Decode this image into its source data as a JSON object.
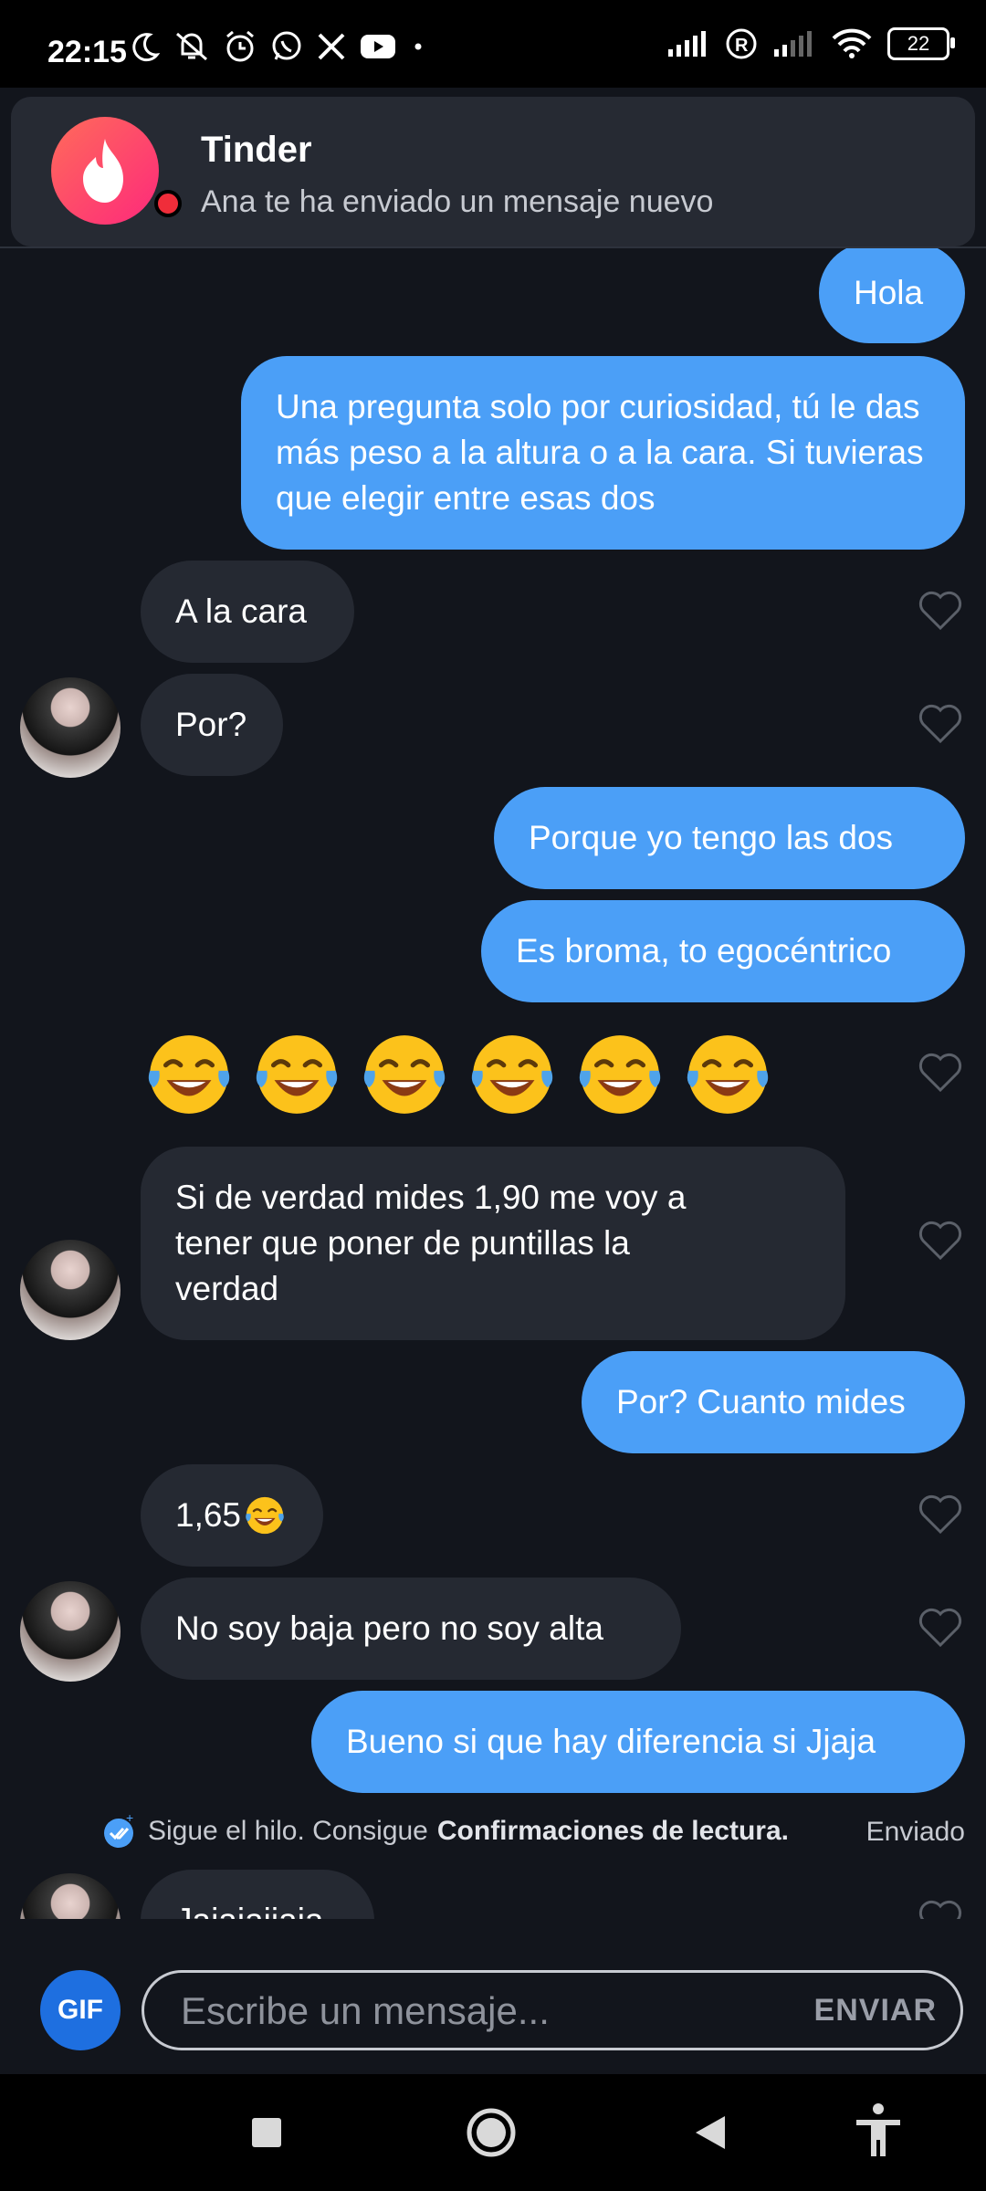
{
  "status_bar": {
    "time": "22:15",
    "battery": "22"
  },
  "notification": {
    "app": "Tinder",
    "text": "Ana te ha enviado un mensaje nuevo"
  },
  "messages": {
    "m1": "Hola",
    "m2": "Una pregunta solo por curiosidad, tú le das más peso a la altura o a la cara. Si tuvieras que elegir entre esas dos",
    "m3": "A la cara",
    "m4": "Por?",
    "m5": "Porque yo tengo las dos",
    "m6": "Es broma, to egocéntrico",
    "m8": "Si de verdad mides 1,90 me voy a tener que poner de puntillas la verdad",
    "m9": "Por? Cuanto mides",
    "m10": "1,65",
    "m11": "No soy baja pero no soy alta",
    "m12": "Bueno si que hay diferencia si Jjaja",
    "m13": "Jajajajjaja"
  },
  "receipt": {
    "prefix": "Sigue el hilo. Consigue",
    "link": "Confirmaciones de lectura.",
    "status": "Enviado"
  },
  "composer": {
    "gif": "GIF",
    "placeholder": "Escribe un mensaje...",
    "send": "ENVIAR"
  },
  "colors": {
    "outgoing_bubble": "#4b9ff7",
    "incoming_bubble": "#252932",
    "background": "#12151c",
    "tinder_gradient_start": "#ff6b5a",
    "tinder_gradient_end": "#fd297b"
  },
  "icons": {
    "emoji_reaction": "tears-of-joy-emoji",
    "like": "heart-outline-icon"
  }
}
